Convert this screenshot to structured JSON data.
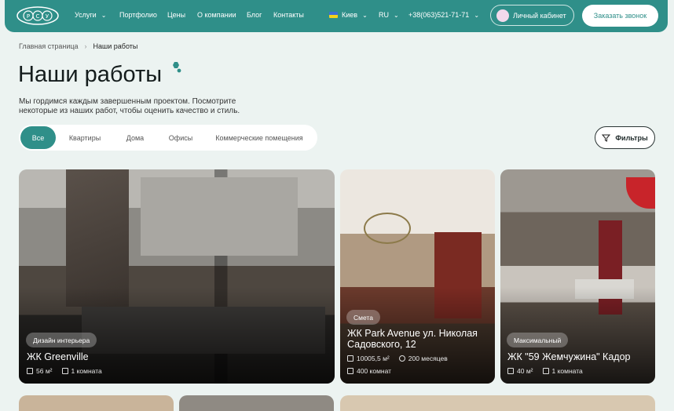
{
  "header": {
    "nav": [
      "Услуги",
      "Портфолио",
      "Цены",
      "О компании",
      "Блог",
      "Контакты"
    ],
    "city": "Киев",
    "lang": "RU",
    "phone": "+38(063)521-71-71",
    "cabinet_label": "Личный кабинет",
    "call_label": "Заказать звонок"
  },
  "breadcrumb": {
    "home": "Главная страница",
    "current": "Наши работы"
  },
  "page": {
    "title": "Наши работы",
    "description": "Мы гордимся каждым завершенным проектом. Посмотрите некоторые из наших работ, чтобы оценить качество и стиль."
  },
  "filters": {
    "tabs": [
      "Все",
      "Квартиры",
      "Дома",
      "Офисы",
      "Коммерческие помещения"
    ],
    "filter_button": "Фильтры"
  },
  "cards": [
    {
      "badge": "Дизайн интерьера",
      "title": "ЖК Greenville",
      "area": "56 м²",
      "rooms": "1 комната"
    },
    {
      "badge": "Смета",
      "title": "ЖК Park Avenue ул. Николая Садовского, 12",
      "area": "10005,5 м²",
      "duration": "200 месяцев",
      "rooms": "400 комнат"
    },
    {
      "badge": "Максимальный",
      "title": "ЖК \"59 Жемчужина\" Кадор",
      "area": "40 м²",
      "rooms": "1 комната"
    }
  ],
  "colors": {
    "brand": "#2f8f89",
    "background": "#ecf3f1"
  }
}
